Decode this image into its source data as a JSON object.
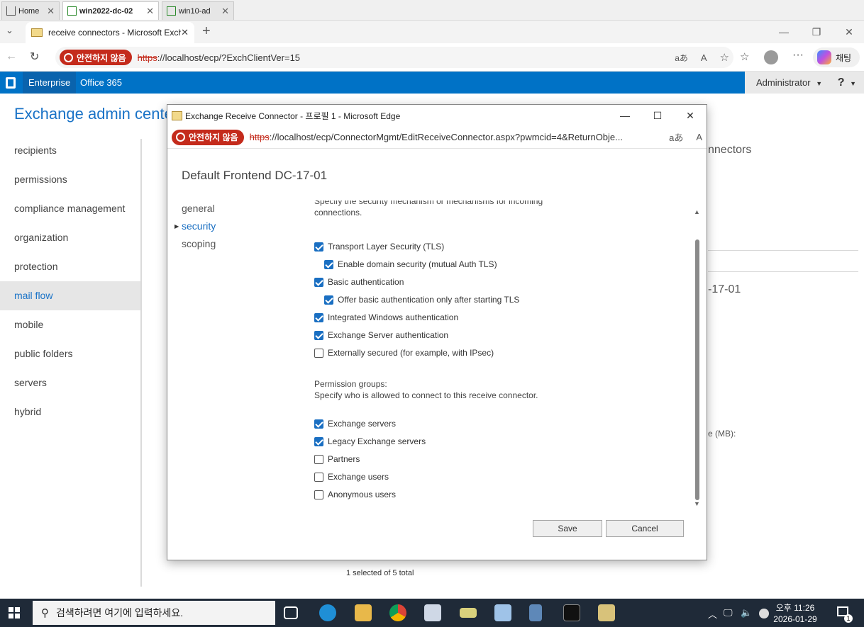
{
  "host_tabs": [
    {
      "label": "Home"
    },
    {
      "label": "win2022-dc-02"
    },
    {
      "label": "win10-ad"
    }
  ],
  "browser": {
    "tab_title": "receive connectors - Microsoft Exchange",
    "security_warning": "안전하지 않음",
    "url_protocol": "https",
    "url_rest": "://localhost/ecp/?ExchClientVer=15",
    "reader_icon_text": "aあ",
    "profile_chat_label": "채팅"
  },
  "ecp": {
    "header": {
      "enterprise": "Enterprise",
      "office365": "Office 365",
      "admin": "Administrator",
      "help": "?"
    },
    "title": "Exchange admin center",
    "nav": [
      {
        "label": "recipients"
      },
      {
        "label": "permissions"
      },
      {
        "label": "compliance management"
      },
      {
        "label": "organization"
      },
      {
        "label": "protection"
      },
      {
        "label": "mail flow",
        "active": true
      },
      {
        "label": "mobile"
      },
      {
        "label": "public folders"
      },
      {
        "label": "servers"
      },
      {
        "label": "hybrid"
      }
    ],
    "bg_tab_fragment": "nnectors",
    "bg_detail_fragment": "-17-01",
    "bg_size_fragment": "e (MB):",
    "status": "1 selected of 5 total"
  },
  "popup": {
    "window_title": "Exchange Receive Connector - 프로필 1 - Microsoft Edge",
    "security_warning": "안전하지 않음",
    "url_protocol": "https",
    "url_rest": "://localhost/ecp/ConnectorMgmt/EditReceiveConnector.aspx?pwmcid=4&ReturnObje...",
    "reader_icon_text": "aあ",
    "heading": "Default Frontend DC-17-01",
    "nav": [
      {
        "label": "general"
      },
      {
        "label": "security",
        "active": true
      },
      {
        "label": "scoping"
      }
    ],
    "intro": "Specify the security mechanism or mechanisms for incoming connections.",
    "auth_options": [
      {
        "label": "Transport Layer Security (TLS)",
        "checked": true
      },
      {
        "label": "Enable domain security (mutual Auth TLS)",
        "checked": true
      },
      {
        "label": "Basic authentication",
        "checked": true
      },
      {
        "label": "Offer basic authentication only after starting TLS",
        "checked": true
      },
      {
        "label": "Integrated Windows authentication",
        "checked": true
      },
      {
        "label": "Exchange Server authentication",
        "checked": true
      },
      {
        "label": "Externally secured (for example, with IPsec)",
        "checked": false
      }
    ],
    "permission_groups_title": "Permission groups:",
    "permission_groups_desc": "Specify who is allowed to connect to this receive connector.",
    "permission_groups": [
      {
        "label": "Exchange servers",
        "checked": true
      },
      {
        "label": "Legacy Exchange servers",
        "checked": true
      },
      {
        "label": "Partners",
        "checked": false
      },
      {
        "label": "Exchange users",
        "checked": false
      },
      {
        "label": "Anonymous users",
        "checked": false
      }
    ],
    "save_label": "Save",
    "cancel_label": "Cancel"
  },
  "taskbar": {
    "search_placeholder": "검색하려면 여기에 입력하세요.",
    "time": "오후 11:26",
    "date": "2026-01-29",
    "notification_count": "1"
  }
}
